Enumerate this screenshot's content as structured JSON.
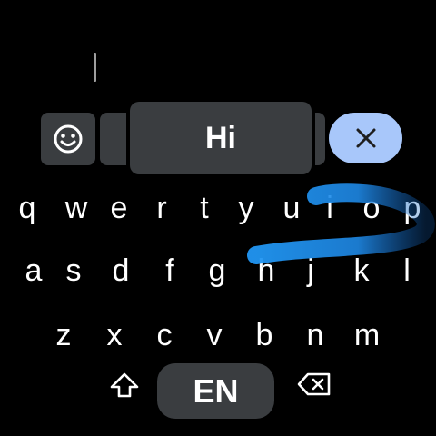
{
  "input": {
    "text": ""
  },
  "suggestion": {
    "primary": "Hi"
  },
  "toolbar": {
    "emoji_icon": "emoji-smile-icon",
    "clear_icon": "close-icon",
    "clear_bg": "#a8c7fa"
  },
  "keyboard": {
    "row1": [
      "q",
      "w",
      "e",
      "r",
      "t",
      "y",
      "u",
      "i",
      "o",
      "p"
    ],
    "row2": [
      "a",
      "s",
      "d",
      "f",
      "g",
      "h",
      "j",
      "k",
      "l"
    ],
    "row3": [
      "z",
      "x",
      "c",
      "v",
      "b",
      "n",
      "m"
    ],
    "language": "EN",
    "shift_icon": "shift-icon",
    "backspace_icon": "backspace-icon"
  },
  "swipe_trail": {
    "color": "#2196f3"
  }
}
